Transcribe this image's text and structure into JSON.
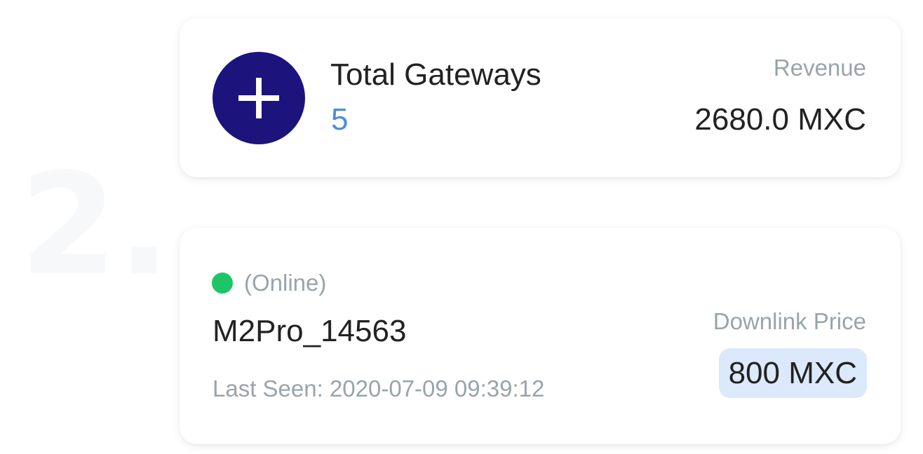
{
  "step": {
    "number": "2."
  },
  "summary": {
    "add_button_icon": "plus-icon",
    "total_label": "Total Gateways",
    "total_count": "5",
    "revenue_label": "Revenue",
    "revenue_value": "2680.0 MXC"
  },
  "gateway": {
    "status_color": "#1dc566",
    "status": "(Online)",
    "name": "M2Pro_14563",
    "last_seen": "Last Seen: 2020-07-09 09:39:12",
    "downlink_label": "Downlink Price",
    "downlink_price": "800 MXC"
  },
  "colors": {
    "accent": "#1c147c",
    "count_blue": "#4a8de0",
    "muted_text": "#98a4ab",
    "price_badge_bg": "#dbe9fb"
  }
}
